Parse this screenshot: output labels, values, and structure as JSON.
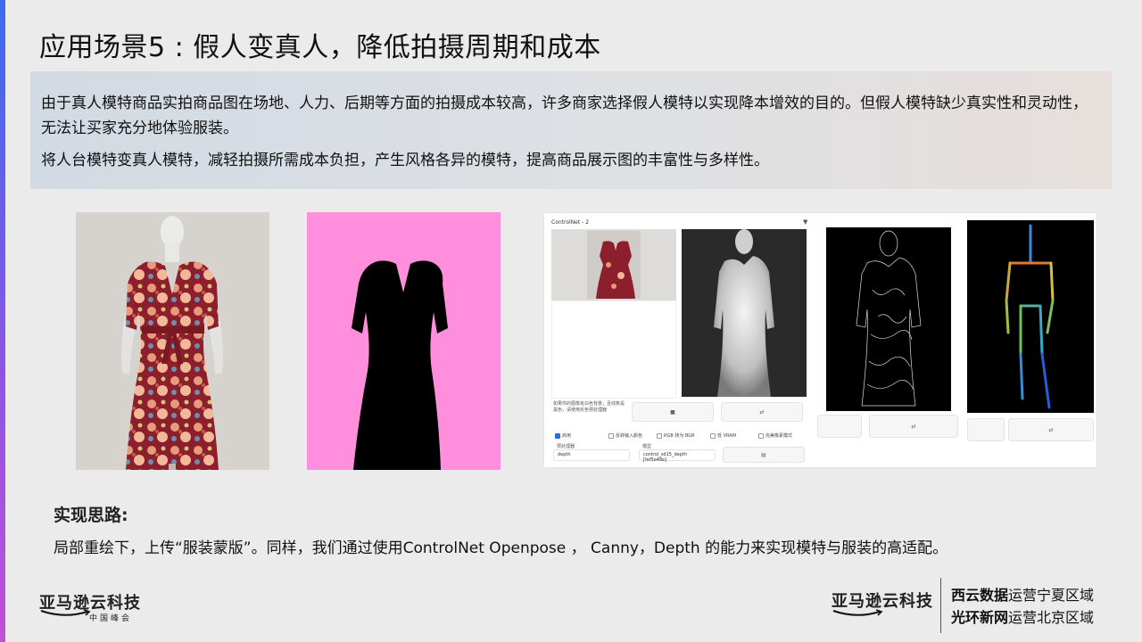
{
  "slide": {
    "title": "应用场景5 : 假人变真人，降低拍摄周期和成本",
    "intro_paragraph_1": "由于真人模特商品实拍商品图在场地、人力、后期等方面的拍摄成本较高，许多商家选择假人模特以实现降本增效的目的。但假人模特缺少真实性和灵动性，无法让买家充分地体验服装。",
    "intro_paragraph_2": "将人台模特变真人模特，减轻拍摄所需成本负担，产生风格各异的模特，提高商品展示图的丰富性与多样性。",
    "method_title": "实现思路:",
    "method_text": "局部重绘下，上传“服装蒙版”。同样，我们通过使用ControlNet Openpose ， Canny，Depth 的能力来实现模特与服装的高适配。"
  },
  "images": {
    "dress_photo": "mannequin-floral-dress-photo",
    "mask_photo": "dress-mask-on-pink",
    "mask_color": "#ff8fdc",
    "ui_screenshot": "controlnet-webui-screenshot"
  },
  "ui_screenshot_content": {
    "panel_title": "ControlNet - 2",
    "enable_label": "启用",
    "low_vram_label": "低 VRAM",
    "pixel_perfect_label": "完美像素模式",
    "invert_label": "反转输入颜色",
    "rgb_bgr_label": "RGB 转为 BGR",
    "preprocessor_label": "预处理器",
    "model_label": "模型",
    "preprocessor_value": "depth",
    "model_value": "control_sd15_depth [fef5e48e]",
    "hint_text": "如果你的图像有白色背景，且线条是黑色，请使用反色预处理器"
  },
  "footer": {
    "logo_left_main": "亚马逊云科技",
    "logo_left_sub": "中国峰会",
    "logo_right_main": "亚马逊云科技",
    "region_1_bold": "西云数据",
    "region_1_rest": "运营宁夏区域",
    "region_2_bold": "光环新网",
    "region_2_rest": "运营北京区域"
  },
  "colors": {
    "accent_top": "#3b6bf0",
    "accent_bottom": "#c150d6",
    "dress_red": "#8c1f2b",
    "openpose_orange": "#e07a2e",
    "openpose_green": "#6cc25a",
    "openpose_blue": "#3a8bd8"
  }
}
